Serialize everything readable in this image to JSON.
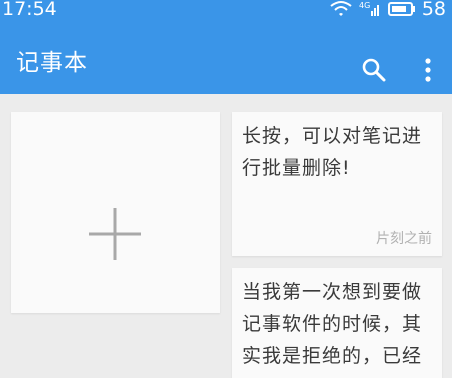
{
  "status_bar": {
    "time": "17:54",
    "network": "4G",
    "battery": "58"
  },
  "app_bar": {
    "title": "记事本",
    "search_icon": "search-icon",
    "more_icon": "more-vert-icon"
  },
  "notes": [
    {
      "text": "长按，可以对笔记进行批量删除!",
      "time": "片刻之前"
    },
    {
      "text": "当我第一次想到要做记事软件的时候，其实我是拒绝的，已经"
    }
  ],
  "add_card": {
    "icon": "plus-icon"
  },
  "colors": {
    "primary": "#3a95e8",
    "background": "#ececec",
    "card": "#fafafa"
  }
}
